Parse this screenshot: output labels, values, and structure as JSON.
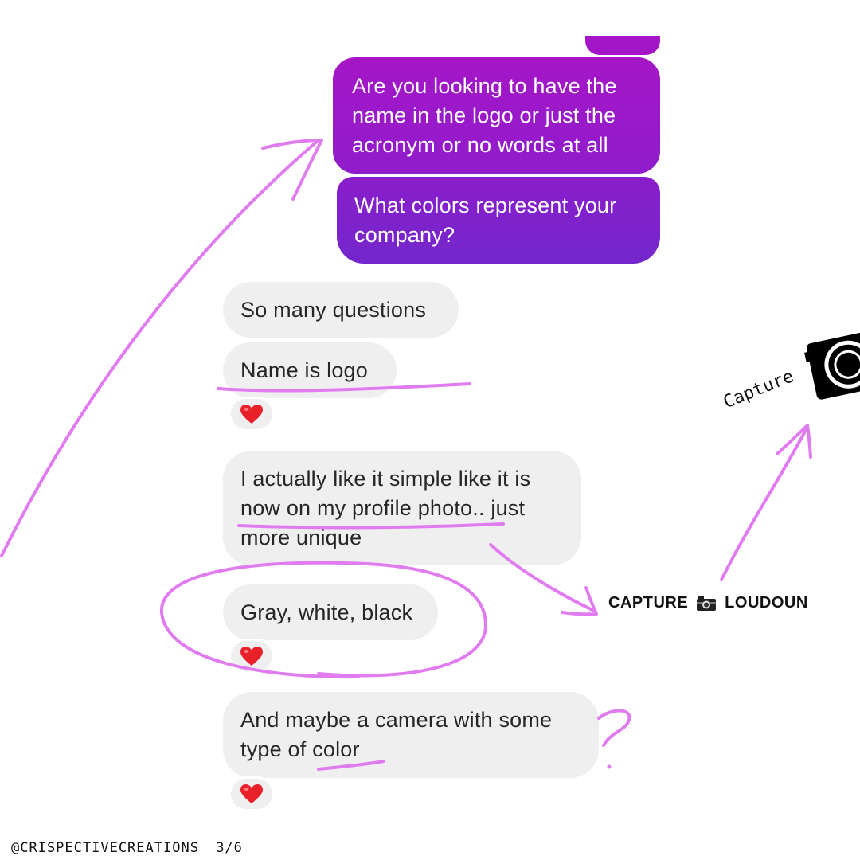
{
  "sent_messages": [
    {
      "text": "Are you looking to have the name in the logo or just the acronym or no words at all"
    },
    {
      "text": "What colors represent your company?"
    }
  ],
  "received_messages": [
    {
      "text": "So many questions"
    },
    {
      "text": "Name is logo"
    },
    {
      "text": "I actually like it simple like it is now on my profile photo.. just more unique"
    },
    {
      "text": "Gray, white, black"
    },
    {
      "text": "And maybe a camera with some type of color"
    }
  ],
  "reactions": [
    "heart-emoji",
    "heart-emoji",
    "heart-emoji"
  ],
  "annotations": {
    "brand_left": "CAPTURE",
    "brand_right": "LOUDOUN",
    "camera_caption": "Capture",
    "question_mark": "?"
  },
  "footer": {
    "handle": "@CRISPECTIVECREATIONS",
    "page": "3/6"
  },
  "colors": {
    "sent_gradient_top": "#a316c8",
    "sent_gradient_bottom": "#7a25cc",
    "received_bubble": "#efefef",
    "annotation_ink": "#e07cf0"
  }
}
